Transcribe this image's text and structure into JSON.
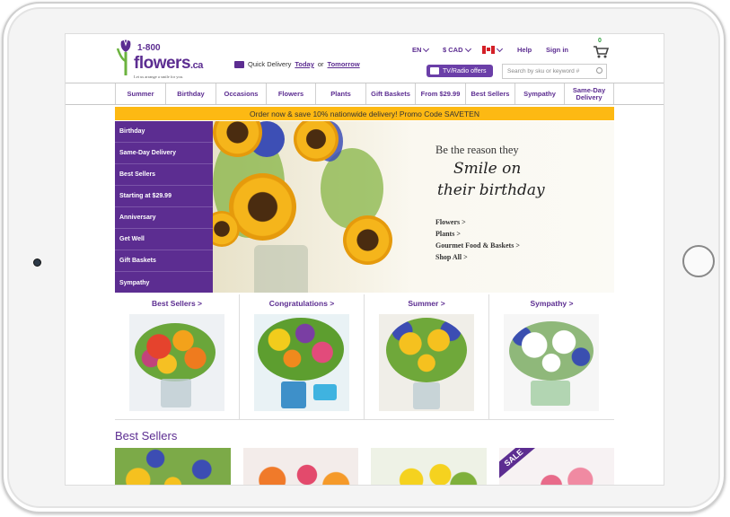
{
  "header": {
    "logo": {
      "number": "1-800",
      "brand": "flowers",
      "suffix": ".ca",
      "tagline": "Let us arrange a smile for you."
    },
    "delivery": {
      "prefix": "Quick Delivery",
      "today": "Today",
      "or": "or",
      "tomorrow": "Tomorrow"
    },
    "language": "EN",
    "currency": "$ CAD",
    "help": "Help",
    "signin": "Sign in",
    "cart_count": "0",
    "tv_radio": "TV/Radio offers",
    "search_placeholder": "Search by sku or keyword #"
  },
  "nav": {
    "items": [
      "Summer",
      "Birthday",
      "Occasions",
      "Flowers",
      "Plants",
      "Gift Baskets",
      "From $29.99",
      "Best Sellers",
      "Sympathy",
      "Same-Day Delivery"
    ]
  },
  "promo": "Order now & save 10% nationwide delivery! Promo Code SAVETEN",
  "left_menu": [
    "Birthday",
    "Same-Day Delivery",
    "Best Sellers",
    "Starting at $29.99",
    "Anniversary",
    "Get Well",
    "Gift Baskets",
    "Sympathy"
  ],
  "hero": {
    "line1": "Be the reason they",
    "line2": "Smile on",
    "line3": "their birthday",
    "links": [
      "Flowers >",
      "Plants >",
      "Gourmet Food & Baskets >",
      "Shop All >"
    ]
  },
  "categories": [
    "Best Sellers >",
    "Congratulations >",
    "Summer >",
    "Sympathy >"
  ],
  "best_sellers_title": "Best Sellers",
  "sale_badge": "SALE",
  "colors": {
    "brand_purple": "#5c2d91",
    "promo_yellow": "#fdb913"
  }
}
